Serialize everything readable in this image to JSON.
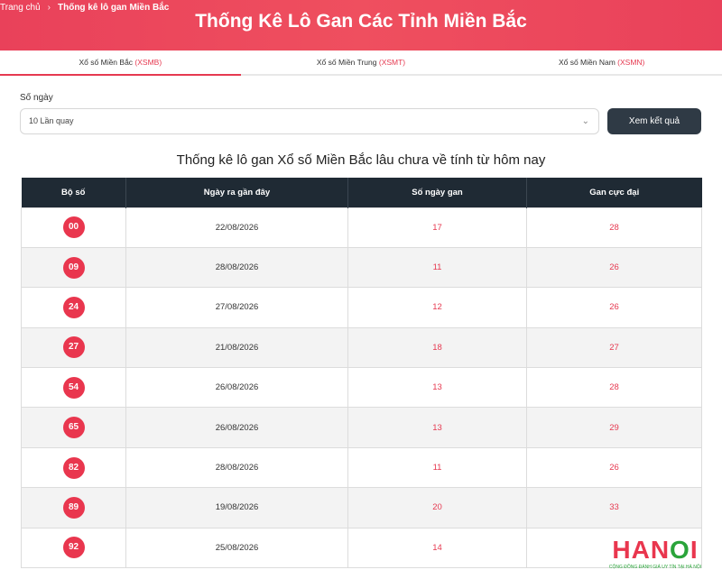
{
  "breadcrumb": {
    "home": "Trang chủ",
    "separator": "›",
    "current": "Thống kê lô gan Miền Bắc"
  },
  "page_title": "Thống Kê Lô Gan Các Tỉnh Miền Bắc",
  "tabs": [
    {
      "label": "Xổ số Miền Bắc ",
      "code": "(XSMB)",
      "active": true
    },
    {
      "label": "Xổ số Miền Trung ",
      "code": "(XSMT)",
      "active": false
    },
    {
      "label": "Xổ số Miền Nam ",
      "code": "(XSMN)",
      "active": false
    }
  ],
  "filter": {
    "label": "Số ngày",
    "selected": "10 Lần quay",
    "chevron_icon": "chevron-down-icon",
    "button": "Xem kết quả"
  },
  "section_title": "Thống kê lô gan Xổ số Miền Bắc lâu chưa về tính từ hôm nay",
  "table": {
    "headers": [
      "Bộ số",
      "Ngày ra gần đây",
      "Số ngày gan",
      "Gan cực đại"
    ],
    "rows": [
      {
        "number": "00",
        "date": "22/08/2026",
        "days": "17",
        "max": "28"
      },
      {
        "number": "09",
        "date": "28/08/2026",
        "days": "11",
        "max": "26"
      },
      {
        "number": "24",
        "date": "27/08/2026",
        "days": "12",
        "max": "26"
      },
      {
        "number": "27",
        "date": "21/08/2026",
        "days": "18",
        "max": "27"
      },
      {
        "number": "54",
        "date": "26/08/2026",
        "days": "13",
        "max": "28"
      },
      {
        "number": "65",
        "date": "26/08/2026",
        "days": "13",
        "max": "29"
      },
      {
        "number": "82",
        "date": "28/08/2026",
        "days": "11",
        "max": "26"
      },
      {
        "number": "89",
        "date": "19/08/2026",
        "days": "20",
        "max": "33"
      },
      {
        "number": "92",
        "date": "25/08/2026",
        "days": "14",
        "max": ""
      }
    ]
  },
  "logo": {
    "text_part1": "HAN",
    "text_part2": "O",
    "text_part3": "I",
    "tagline": "CỘNG ĐỒNG ĐÁNH GIÁ UY TÍN TẠI HÀ NỘI"
  },
  "colors": {
    "accent": "#e63950",
    "header_dark": "#1f2a34",
    "button_dark": "#2f3a45"
  }
}
